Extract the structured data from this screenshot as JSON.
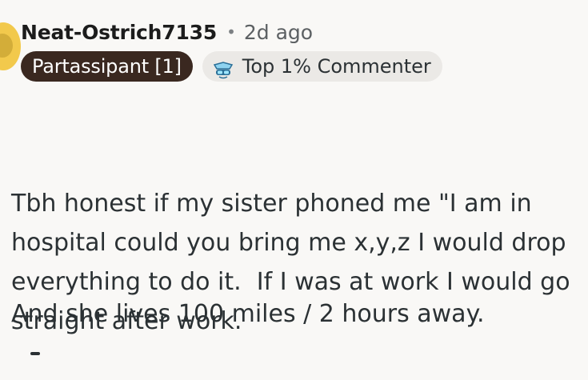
{
  "comment": {
    "username": "Neat-Ostrich7135",
    "separator": "•",
    "time_ago": "2d ago",
    "flair": "Partassipant [1]",
    "badge": {
      "label": "Top 1% Commenter",
      "icon": "top-commenter-icon"
    },
    "paragraphs": [
      "Tbh honest if my sister phoned me \"I am in hospital could you bring me x,y,z I would drop everything to do it.  If I was at work I would go straight after work.",
      "And she lives 100 miles / 2 hours away."
    ]
  },
  "colors": {
    "background": "#f9f8f6",
    "flair_background": "#3a2820",
    "badge_background": "#ebe9e6",
    "avatar": "#f2c94c",
    "text": "#2b3134"
  }
}
